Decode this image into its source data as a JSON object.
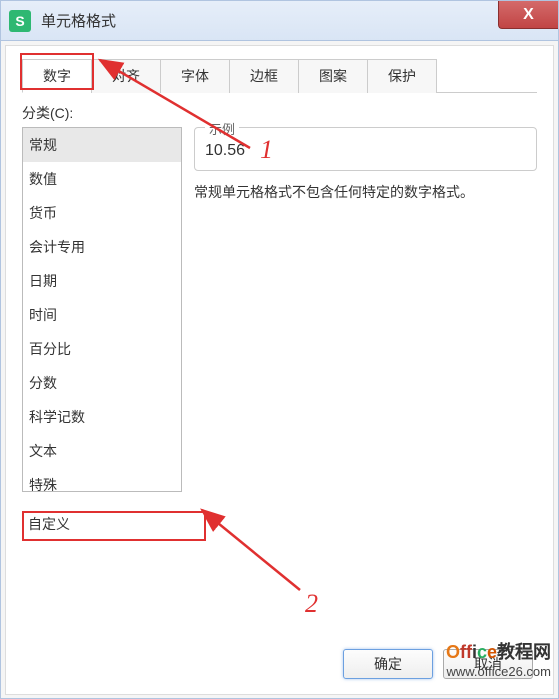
{
  "window": {
    "title": "单元格格式",
    "close": "X"
  },
  "tabs": {
    "number": "数字",
    "align": "对齐",
    "font": "字体",
    "border": "边框",
    "pattern": "图案",
    "protect": "保护"
  },
  "category": {
    "label": "分类(C):",
    "items": {
      "general": "常规",
      "number": "数值",
      "currency": "货币",
      "accounting": "会计专用",
      "date": "日期",
      "time": "时间",
      "percent": "百分比",
      "fraction": "分数",
      "scientific": "科学记数",
      "text": "文本",
      "special": "特殊",
      "custom": "自定义"
    }
  },
  "sample": {
    "label": "示例",
    "value": "10.56"
  },
  "description": "常规单元格格式不包含任何特定的数字格式。",
  "buttons": {
    "ok": "确定",
    "cancel": "取消"
  },
  "annotations": {
    "one": "1",
    "two": "2"
  },
  "watermark": {
    "logo_prefix": "O",
    "logo_f": "f",
    "logo_f2": "f",
    "logo_i": "i",
    "logo_c": "c",
    "logo_e": "e",
    "logo_suffix": "教程网",
    "url": "www.office26.com"
  }
}
